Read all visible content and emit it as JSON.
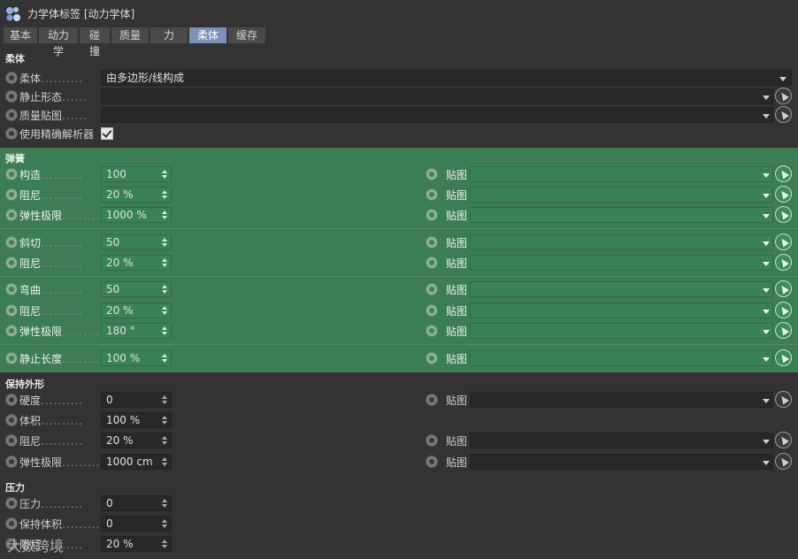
{
  "window": {
    "title": "力学体标签 [动力学体]"
  },
  "tabs": [
    "基本",
    "动力学",
    "碰撞",
    "质量",
    "力",
    "柔体",
    "缓存"
  ],
  "active_tab": "柔体",
  "softbody": {
    "title": "柔体",
    "softbody_label": "柔体",
    "softbody_value": "由多边形/线构成",
    "rest_shape_label": "静止形态",
    "mass_map_label": "质量贴图",
    "use_solver_label": "使用精确解析器",
    "use_solver_checked": true
  },
  "springs": {
    "title": "弹簧",
    "map_label": "贴图",
    "rows": [
      {
        "label": "构造",
        "value": "100"
      },
      {
        "label": "阻尼",
        "value": "20 %"
      },
      {
        "label": "弹性极限",
        "value": "1000 %"
      },
      {
        "label": "斜切",
        "value": "50"
      },
      {
        "label": "阻尼",
        "value": "20 %"
      },
      {
        "label": "弯曲",
        "value": "50"
      },
      {
        "label": "阻尼",
        "value": "20 %"
      },
      {
        "label": "弹性极限",
        "value": "180 °"
      },
      {
        "label": "静止长度",
        "value": "100 %"
      }
    ]
  },
  "shape": {
    "title": "保持外形",
    "map_label": "贴图",
    "rows": [
      {
        "label": "硬度",
        "value": "0"
      },
      {
        "label": "体积",
        "value": "100 %"
      },
      {
        "label": "阻尼",
        "value": "20 %"
      },
      {
        "label": "弹性极限",
        "value": "1000 cm"
      }
    ]
  },
  "pressure": {
    "title": "压力",
    "rows": [
      {
        "label": "压力",
        "value": "0"
      },
      {
        "label": "保持体积",
        "value": "0"
      },
      {
        "label": "阻尼",
        "value": "20 %"
      }
    ]
  },
  "watermark": "大数跨境",
  "colors": {
    "accent_tab": "#7a92b8",
    "green_panel": "#3d7d55",
    "background": "#333333"
  },
  "icons": {
    "tag": "dynamics-tag-icon",
    "picker": "picker-arrow-icon",
    "dropdown": "chevron-down-icon",
    "spinner": "spinner-arrows-icon"
  }
}
